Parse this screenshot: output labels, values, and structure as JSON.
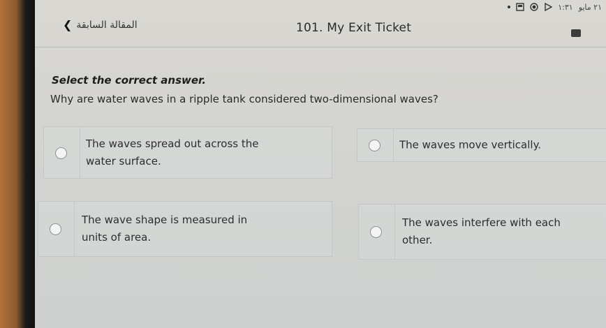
{
  "status_bar": {
    "time": "١:٣١",
    "date": "٢١ مايو"
  },
  "header": {
    "back_label": "المقالة السابقة",
    "title": "101. My Exit Ticket"
  },
  "quiz": {
    "instruction": "Select the correct answer.",
    "question": "Why are water waves in a ripple tank considered two-dimensional waves?",
    "options": [
      {
        "label": "The waves spread out across the water surface."
      },
      {
        "label": "The waves move vertically."
      },
      {
        "label": "The wave shape is measured in units of area."
      },
      {
        "label": "The waves interfere with each other."
      }
    ]
  }
}
